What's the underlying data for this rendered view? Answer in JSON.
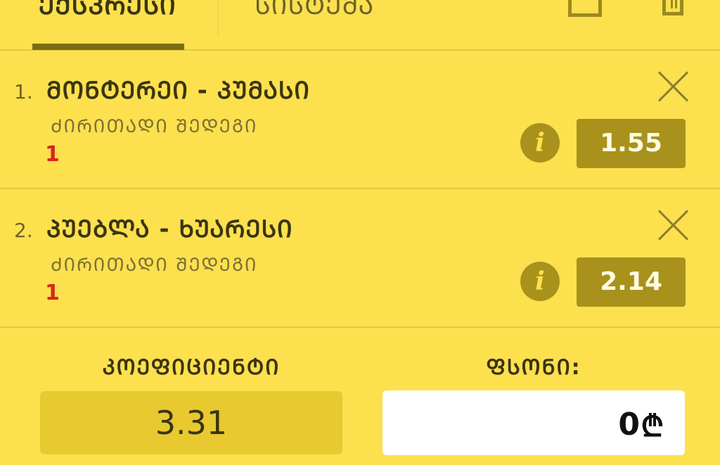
{
  "tabs": {
    "active": "ᲔᲥᲡᲞᲠᲔᲡᲘ",
    "inactive": "ᲡᲘᲡᲢᲔᲛᲐ"
  },
  "toolbar": {
    "save_icon": "save-icon",
    "trash_icon": "trash-icon"
  },
  "bets": [
    {
      "num": "1.",
      "title": "ᲛᲝᲜᲢᲔᲠᲔᲘ - ᲞᲣᲛᲐᲡᲘ",
      "market": "ᲫᲘᲠᲘᲗᲐᲓᲘ ᲨᲔᲓᲔᲒᲘ",
      "pick": "1",
      "odds": "1.55"
    },
    {
      "num": "2.",
      "title": "ᲞᲣᲔᲑᲚᲐ - ᲮᲣᲐᲠᲔᲡᲘ",
      "market": "ᲫᲘᲠᲘᲗᲐᲓᲘ ᲨᲔᲓᲔᲒᲘ",
      "pick": "1",
      "odds": "2.14"
    }
  ],
  "summary": {
    "coef_label": "ᲙᲝᲔᲤᲘᲪᲘᲔᲜᲢᲘ",
    "coef_value": "3.31",
    "stake_label": "ᲤᲡᲝᲜᲘ:",
    "stake_value": "0",
    "currency": "₾"
  },
  "colors": {
    "background": "#fde04e",
    "accent_dark": "#a8921c",
    "pick_red": "#d7261e"
  }
}
